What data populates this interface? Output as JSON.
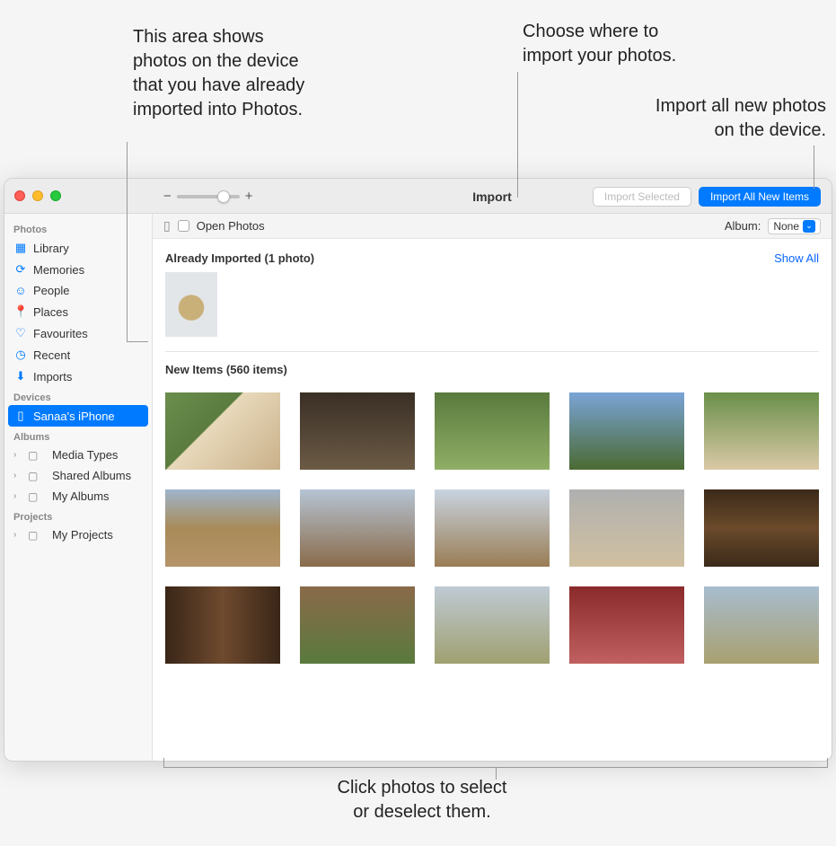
{
  "callouts": {
    "already": "This area shows\nphotos on the device\nthat you have already\nimported into Photos.",
    "choose": "Choose where to\nimport your photos.",
    "importall": "Import all new photos\non the device.",
    "select": "Click photos to select\nor deselect them."
  },
  "toolbar": {
    "title": "Import",
    "import_selected": "Import Selected",
    "import_all": "Import All New Items"
  },
  "subbar": {
    "open_photos": "Open Photos",
    "album_label": "Album:",
    "album_value": "None"
  },
  "sections": {
    "already_imported": "Already Imported (1 photo)",
    "show_all": "Show All",
    "new_items": "New Items (560 items)"
  },
  "sidebar": {
    "photos_header": "Photos",
    "devices_header": "Devices",
    "albums_header": "Albums",
    "projects_header": "Projects",
    "items": {
      "library": "Library",
      "memories": "Memories",
      "people": "People",
      "places": "Places",
      "favourites": "Favourites",
      "recent": "Recent",
      "imports": "Imports",
      "device": "Sanaa's iPhone",
      "mediatypes": "Media Types",
      "sharedalbums": "Shared Albums",
      "myalbums": "My Albums",
      "myprojects": "My Projects"
    }
  }
}
